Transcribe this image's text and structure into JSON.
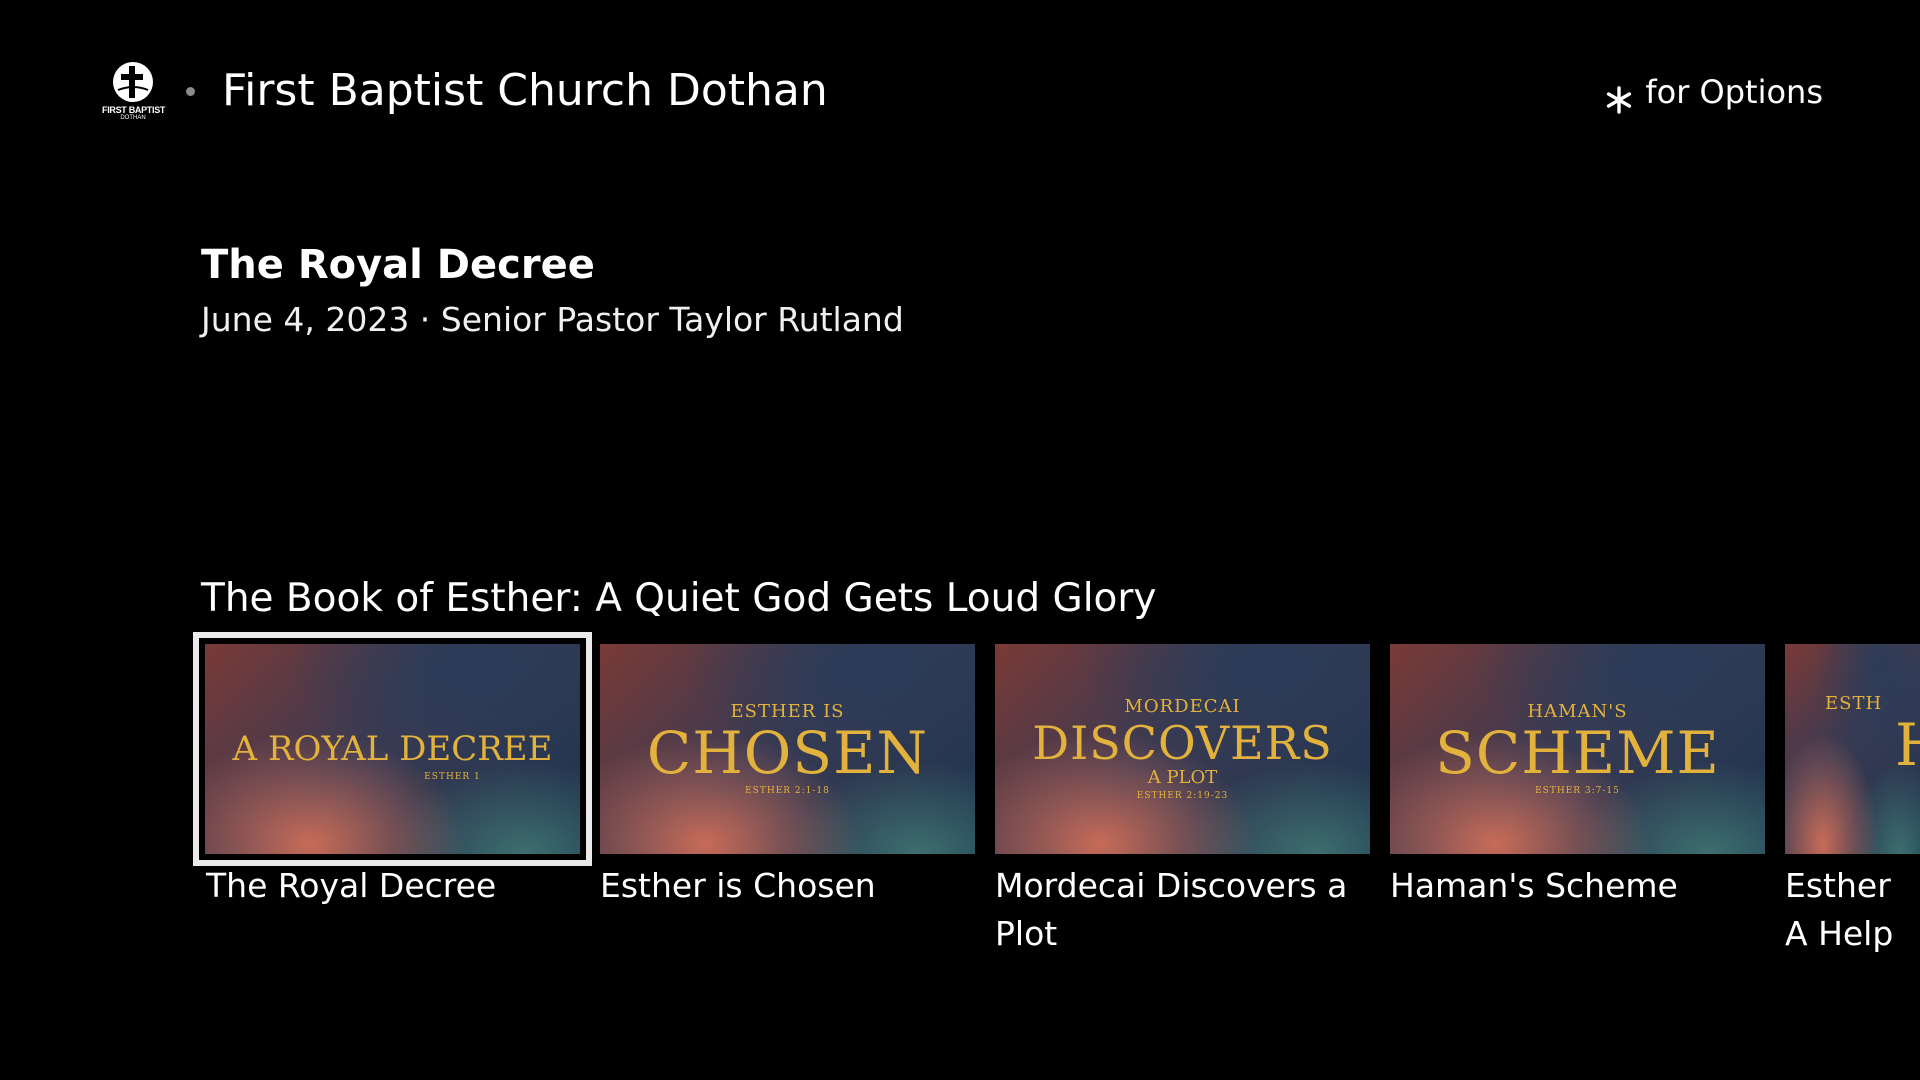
{
  "header": {
    "logo_line1": "FIRST BAPTIST",
    "logo_line2": "DOTHAN",
    "channel_title": "First Baptist Church Dothan",
    "options_hint": "for Options",
    "options_icon": "asterisk-icon"
  },
  "details": {
    "title": "The Royal Decree",
    "meta": "June 4, 2023 · Senior Pastor Taylor Rutland"
  },
  "row": {
    "title": "The Book of Esther: A Quiet God Gets Loud Glory",
    "items": [
      {
        "label": "The Royal Decree",
        "art_top": "",
        "art_main": "A ROYAL DECREE",
        "art_sub": "",
        "art_ref": "ESTHER 1",
        "focused": true
      },
      {
        "label": "Esther is Chosen",
        "art_top": "ESTHER IS",
        "art_main": "CHOSEN",
        "art_sub": "",
        "art_ref": "ESTHER 2:1-18",
        "focused": false
      },
      {
        "label": "Mordecai Discovers a Plot",
        "art_top": "MORDECAI",
        "art_main": "DISCOVERS",
        "art_sub": "A PLOT",
        "art_ref": "ESTHER 2:19-23",
        "focused": false
      },
      {
        "label": "Haman's Scheme",
        "art_top": "HAMAN'S",
        "art_main": "SCHEME",
        "art_sub": "",
        "art_ref": "ESTHER 3:7-15",
        "focused": false
      },
      {
        "label": "Esther A Help",
        "art_top": "ESTH",
        "art_main": "H",
        "art_sub": "",
        "art_ref": "",
        "focused": false
      }
    ]
  }
}
